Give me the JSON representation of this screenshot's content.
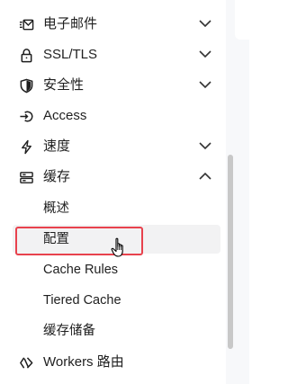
{
  "nav": {
    "items": [
      {
        "label": "电子邮件",
        "icon": "email-routing-icon",
        "chevron": "down"
      },
      {
        "label": "SSL/TLS",
        "icon": "lock-icon",
        "chevron": "down"
      },
      {
        "label": "安全性",
        "icon": "shield-icon",
        "chevron": "down"
      },
      {
        "label": "Access",
        "icon": "access-login-icon",
        "chevron": ""
      },
      {
        "label": "速度",
        "icon": "lightning-icon",
        "chevron": "down"
      },
      {
        "label": "缓存",
        "icon": "cache-drive-icon",
        "chevron": "up"
      }
    ],
    "cache_submenu": [
      {
        "label": "概述"
      },
      {
        "label": "配置",
        "active": true
      },
      {
        "label": "Cache Rules"
      },
      {
        "label": "Tiered Cache"
      },
      {
        "label": "缓存储备"
      }
    ],
    "workers": {
      "label": "Workers 路由",
      "icon": "workers-icon"
    }
  },
  "colors": {
    "highlight": "#e8424d",
    "active_bg": "#f2f2f3",
    "text": "#1f1f1f",
    "scrollbar": "#c8c8c8"
  }
}
